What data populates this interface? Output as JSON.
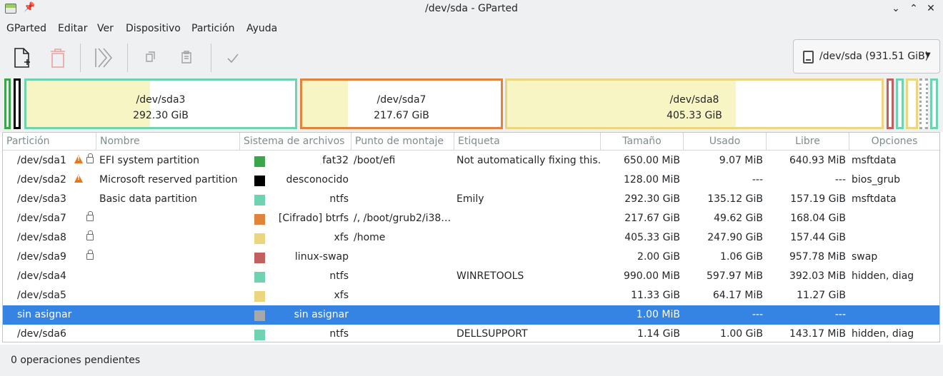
{
  "window": {
    "title": "/dev/sda - GParted"
  },
  "menu": [
    "GParted",
    "Editar",
    "Ver",
    "Dispositivo",
    "Partición",
    "Ayuda"
  ],
  "toolbar": {
    "icons": [
      "new-partition-icon",
      "delete-partition-icon",
      "resize-move-icon",
      "copy-icon",
      "paste-icon",
      "apply-icon"
    ]
  },
  "device": {
    "label": "/dev/sda (931.51 GiB)"
  },
  "diskmap": {
    "sda3": {
      "name": "/dev/sda3",
      "size": "292.30 GiB",
      "color": "#6fd2b0",
      "used_fraction": 0.46
    },
    "sda7": {
      "name": "/dev/sda7",
      "size": "217.67 GiB",
      "color": "#e0843d",
      "used_fraction": 0.23
    },
    "sda8": {
      "name": "/dev/sda8",
      "size": "405.33 GiB",
      "color": "#ecd57f",
      "used_fraction": 0.61
    }
  },
  "table": {
    "headers": [
      "Partición",
      "Nombre",
      "Sistema de archivos",
      "Punto de montaje",
      "Etiqueta",
      "Tamaño",
      "Usado",
      "Libre",
      "Opciones"
    ],
    "rows": [
      {
        "partition": "/dev/sda1",
        "warn": true,
        "lock": true,
        "name": "EFI system partition",
        "color": "#3aa54a",
        "fs": "fat32",
        "mount": "/boot/efi",
        "label": "Not automatically fixing this.",
        "size": "650.00 MiB",
        "used": "9.07 MiB",
        "free": "640.93 MiB",
        "flags": "msftdata"
      },
      {
        "partition": "/dev/sda2",
        "warn": true,
        "lock": false,
        "name": "Microsoft reserved partition",
        "color": "#000000",
        "fs": "desconocido",
        "mount": "",
        "label": "",
        "size": "128.00 MiB",
        "used": "---",
        "free": "---",
        "flags": "bios_grub"
      },
      {
        "partition": "/dev/sda3",
        "warn": false,
        "lock": false,
        "name": "Basic data partition",
        "color": "#6fd2b0",
        "fs": "ntfs",
        "mount": "",
        "label": "Emily",
        "size": "292.30 GiB",
        "used": "135.12 GiB",
        "free": "157.19 GiB",
        "flags": "msftdata"
      },
      {
        "partition": "/dev/sda7",
        "warn": false,
        "lock": true,
        "name": "",
        "color": "#e0843d",
        "fs": "[Cifrado] btrfs",
        "mount": "/, /boot/grub2/i38…",
        "label": "",
        "size": "217.67 GiB",
        "used": "49.62 GiB",
        "free": "168.04 GiB",
        "flags": ""
      },
      {
        "partition": "/dev/sda8",
        "warn": false,
        "lock": true,
        "name": "",
        "color": "#ecd57f",
        "fs": "xfs",
        "mount": "/home",
        "label": "",
        "size": "405.33 GiB",
        "used": "247.90 GiB",
        "free": "157.44 GiB",
        "flags": ""
      },
      {
        "partition": "/dev/sda9",
        "warn": false,
        "lock": true,
        "name": "",
        "color": "#c06060",
        "fs": "linux-swap",
        "mount": "",
        "label": "",
        "size": "2.00 GiB",
        "used": "1.06 GiB",
        "free": "957.78 MiB",
        "flags": "swap"
      },
      {
        "partition": "/dev/sda4",
        "warn": false,
        "lock": false,
        "name": "",
        "color": "#6fd2b0",
        "fs": "ntfs",
        "mount": "",
        "label": "WINRETOOLS",
        "size": "990.00 MiB",
        "used": "597.97 MiB",
        "free": "392.03 MiB",
        "flags": "hidden, diag"
      },
      {
        "partition": "/dev/sda5",
        "warn": false,
        "lock": false,
        "name": "",
        "color": "#ecd57f",
        "fs": "xfs",
        "mount": "",
        "label": "",
        "size": "11.33 GiB",
        "used": "64.17 MiB",
        "free": "11.27 GiB",
        "flags": ""
      },
      {
        "partition": "sin asignar",
        "warn": false,
        "lock": false,
        "name": "",
        "color": "#a8a8a8",
        "fs": "sin asignar",
        "mount": "",
        "label": "",
        "size": "1.00 MiB",
        "used": "---",
        "free": "---",
        "flags": "",
        "selected": true
      },
      {
        "partition": "/dev/sda6",
        "warn": false,
        "lock": false,
        "name": "",
        "color": "#6fd2b0",
        "fs": "ntfs",
        "mount": "",
        "label": "DELLSUPPORT",
        "size": "1.14 GiB",
        "used": "1.00 GiB",
        "free": "143.17 MiB",
        "flags": "hidden, diag"
      }
    ]
  },
  "status": {
    "text": "0 operaciones pendientes"
  }
}
